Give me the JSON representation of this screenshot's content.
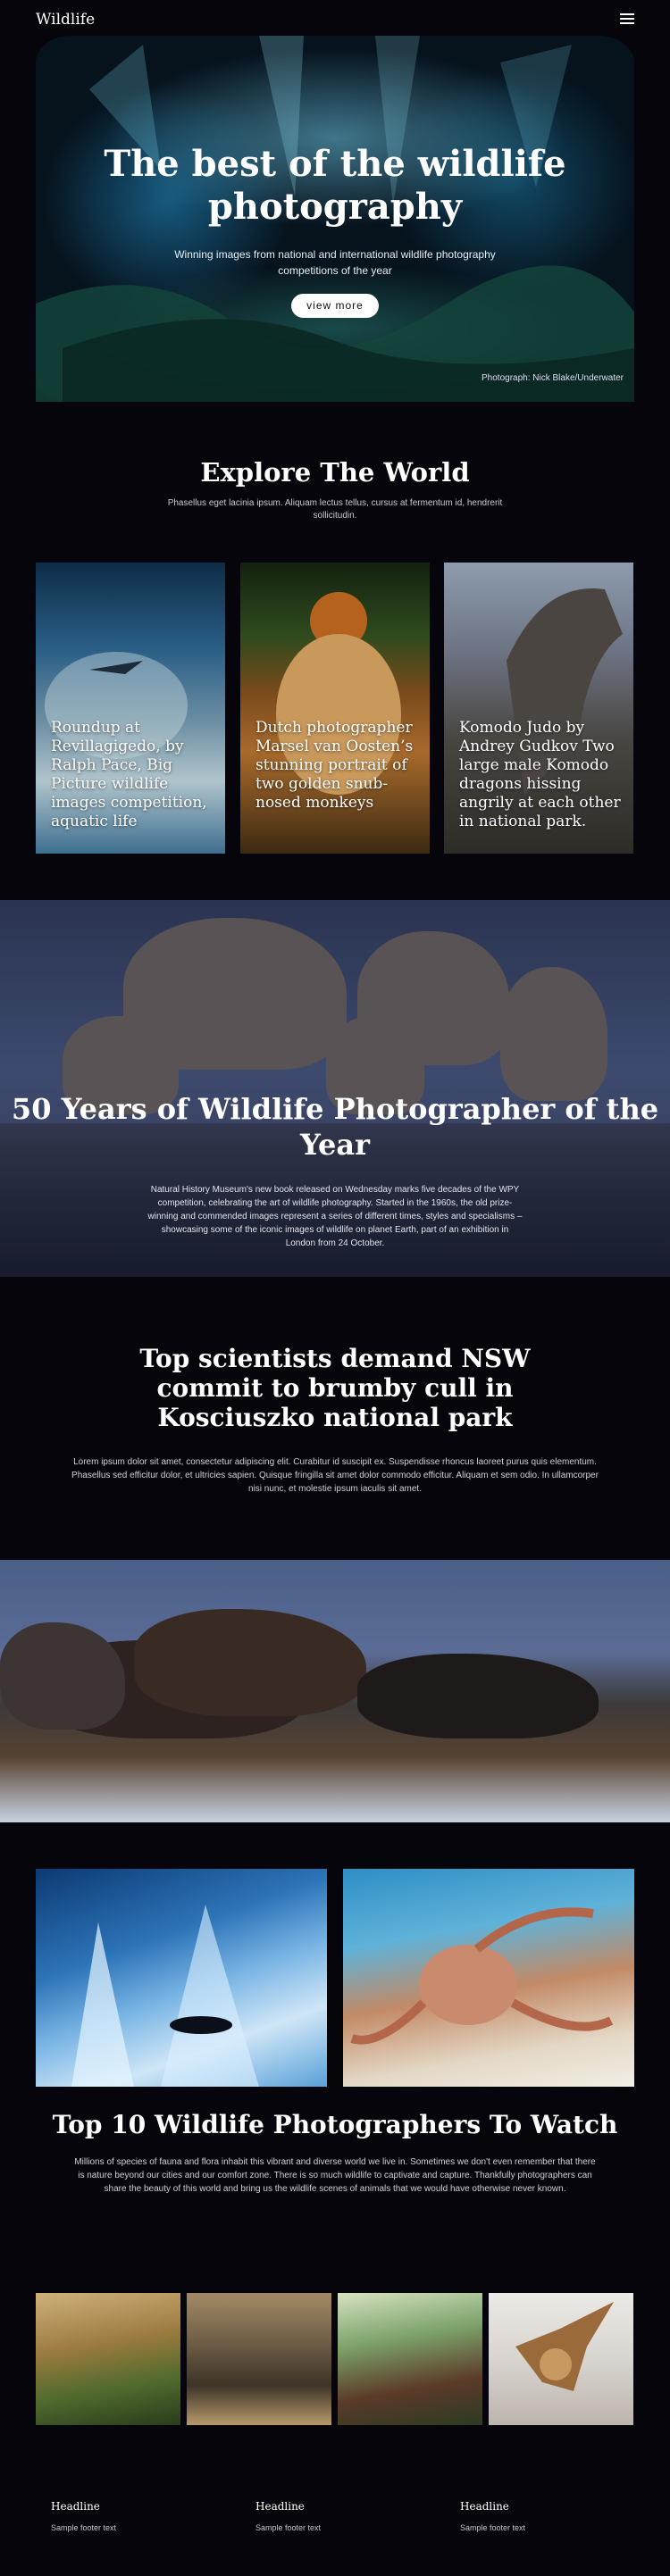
{
  "header": {
    "logo": "Wildlife",
    "menu_icon": "hamburger-menu-icon"
  },
  "hero": {
    "title": "The best of the wildlife photography",
    "subtitle": "Winning images from national and international wildlife photography competitions of the year",
    "button_label": "view more",
    "credit": "Photograph: Nick Blake/Underwater"
  },
  "explore": {
    "title": "Explore The World",
    "text": "Phasellus eget lacinia ipsum. Aliquam lectus tellus, cursus at fermentum id, hendrerit sollicitudin.",
    "cards": [
      {
        "caption": "Roundup at Revillagigedo, by Ralph Pace, Big Picture wildlife images competition, aquatic life"
      },
      {
        "caption": "Dutch photographer Marsel van Oosten’s stunning portrait of two  golden snub-nosed monkeys"
      },
      {
        "caption": "Komodo Judo by Andrey Gudkov Two large male Komodo dragons hissing angrily at each other in national park."
      }
    ]
  },
  "feature": {
    "title": "50 Years of Wildlife Photographer of the Year",
    "text": "Natural History Museum's new book released on Wednesday marks five decades of the WPY competition, celebrating the art of wildlife photography. Started in the 1960s, the old prize-winning and commended images represent a series of different times, styles and specialisms – showcasing some of the iconic images of wildlife on planet Earth, part of an exhibition in London from 24 October."
  },
  "news": {
    "title": "Top scientists demand NSW commit to brumby cull in Kosciuszko national park",
    "text": "Lorem ipsum dolor sit amet, consectetur adipiscing elit. Curabitur id suscipit ex. Suspendisse rhoncus laoreet purus quis elementum. Phasellus sed efficitur dolor, et ultricies sapien. Quisque fringilla sit amet dolor commodo efficitur. Aliquam et sem odio. In ullamcorper nisi nunc, et molestie ipsum iaculis sit amet."
  },
  "top10": {
    "title": "Top 10 Wildlife Photographers To Watch",
    "text": "Millions of species of fauna and flora inhabit this vibrant and diverse world we live in. Sometimes we don't even remember that there is nature beyond our cities and our comfort zone. There is so much wildlife to captivate and capture. Thankfully photographers can share the beauty of this world and bring us the wildlife scenes of animals that we would have otherwise never known."
  },
  "footer": {
    "columns": [
      {
        "headline": "Headline",
        "text": "Sample footer text"
      },
      {
        "headline": "Headline",
        "text": "Sample footer text"
      },
      {
        "headline": "Headline",
        "text": "Sample footer text"
      }
    ]
  }
}
